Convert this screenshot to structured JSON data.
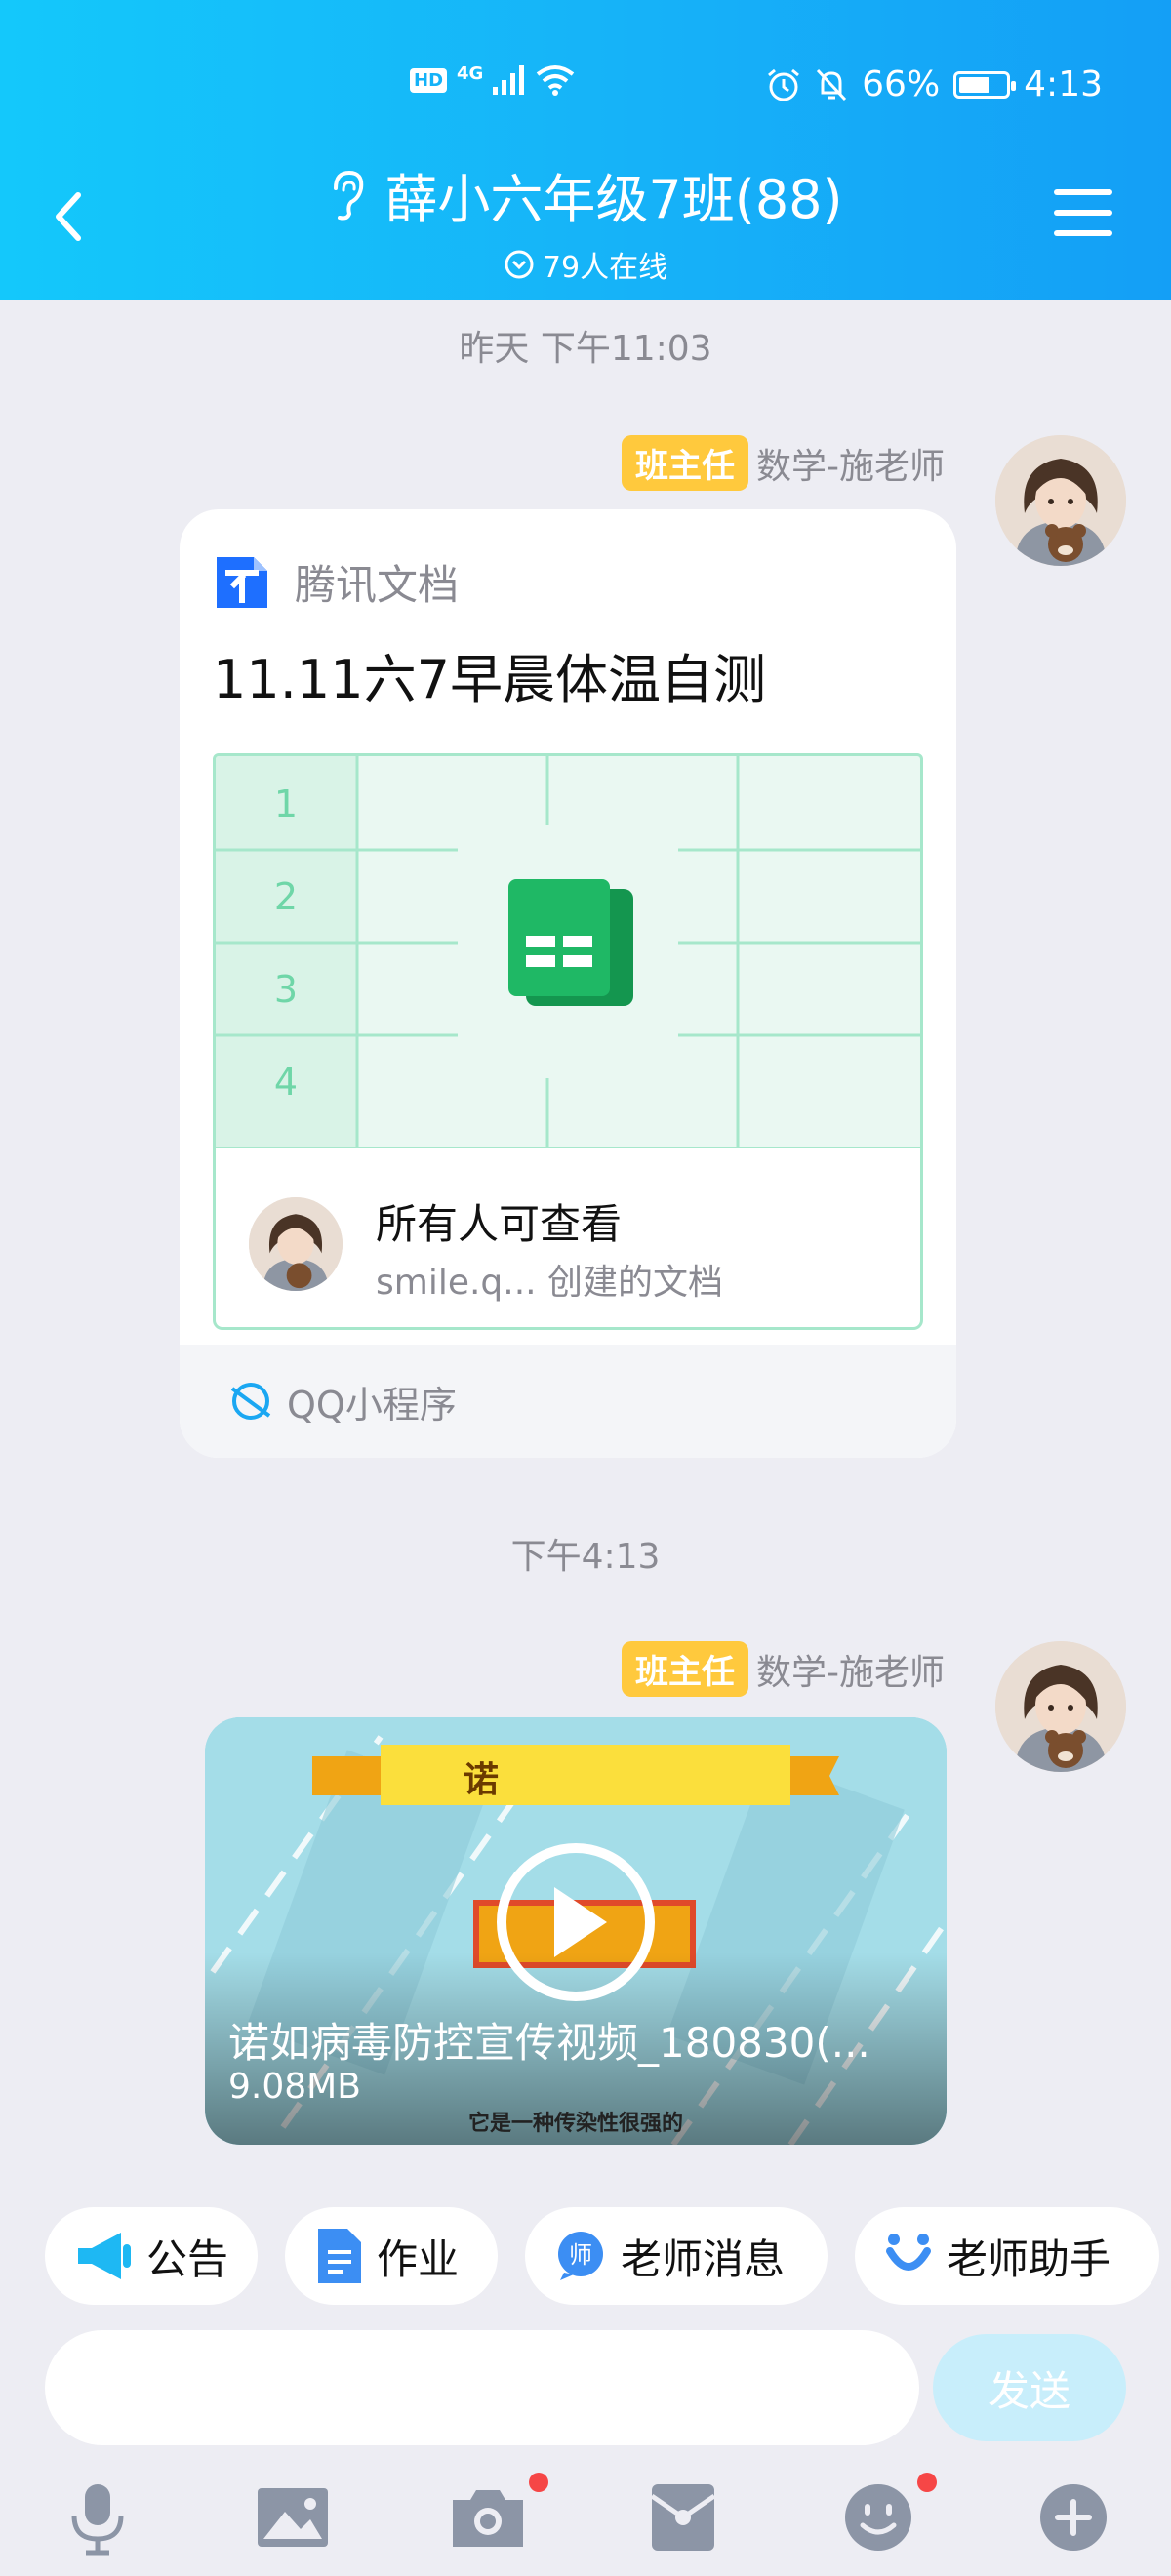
{
  "status_bar": {
    "hd": "HD",
    "network": "4G",
    "battery": "66%",
    "battery_level": 0.66,
    "time": "4:13"
  },
  "header": {
    "title": "薛小六年级7班(88)",
    "online": "79人在线"
  },
  "messages": [
    {
      "time": "昨天 下午11:03",
      "badge": "班主任",
      "sender": "数学-施老师",
      "card": {
        "app": "腾讯文档",
        "title": "11.11六7早晨体温自测",
        "rows": [
          "1",
          "2",
          "3",
          "4"
        ],
        "permission": "所有人可查看",
        "creator": "smile.q... 创建的文档",
        "mini_program": "QQ小程序"
      }
    },
    {
      "time": "下午4:13",
      "badge": "班主任",
      "sender": "数学-施老师",
      "video": {
        "banner": "诺",
        "title": "诺如病毒防控宣传视频_180830(...",
        "size": "9.08MB",
        "subtitle": "它是一种传染性很强的"
      }
    }
  ],
  "quick_actions": [
    "公告",
    "作业",
    "老师消息",
    "老师助手"
  ],
  "input": {
    "send": "发送"
  },
  "colors": {
    "header_start": "#14C8FB",
    "header_end": "#149FF6",
    "badge": "#FFC93D",
    "doc_green": "#1FAA5F",
    "red_dot": "#F64646"
  }
}
